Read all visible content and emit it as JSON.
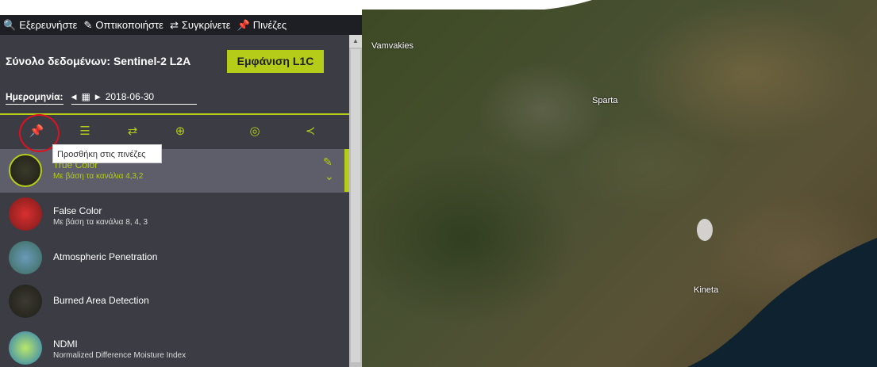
{
  "tabs": [
    {
      "icon": "search-icon",
      "glyph": "🔍",
      "label": "Εξερευνήστε"
    },
    {
      "icon": "brush-icon",
      "glyph": "✎",
      "label": "Οπτικοποιήστε"
    },
    {
      "icon": "compare-icon",
      "glyph": "⇄",
      "label": "Συγκρίνετε"
    },
    {
      "icon": "pin-icon",
      "glyph": "📌",
      "label": "Πινέζες"
    }
  ],
  "dataset": {
    "title": "Σύνολο δεδομένων: Sentinel-2 L2A",
    "button": "Εμφάνιση L1C"
  },
  "date": {
    "label": "Ημερομηνία:",
    "value": "2018-06-30",
    "prev": "◀",
    "next": "▶",
    "calendar": "▦"
  },
  "toolbar": [
    {
      "name": "pin-icon",
      "glyph": "📌"
    },
    {
      "name": "sliders-icon",
      "glyph": "☰"
    },
    {
      "name": "compare-icon",
      "glyph": "⇄"
    },
    {
      "name": "crosshair-icon",
      "glyph": "⊕"
    },
    {
      "name": "eye-slash-icon",
      "glyph": "◎"
    },
    {
      "name": "share-icon",
      "glyph": "≺"
    }
  ],
  "tooltip": "Προσθήκη στις πινέζες",
  "layers": [
    {
      "title": "True Color",
      "subtitle": "Με βάση τα κανάλια 4,3,2",
      "active": true
    },
    {
      "title": "False Color",
      "subtitle": "Με βάση τα κανάλια 8, 4, 3",
      "active": false
    },
    {
      "title": "Atmospheric Penetration",
      "subtitle": "",
      "active": false
    },
    {
      "title": "Burned Area Detection",
      "subtitle": "",
      "active": false
    },
    {
      "title": "NDMI",
      "subtitle": "Normalized Difference Moisture Index",
      "active": false
    }
  ],
  "layer_actions": {
    "edit_glyph": "✎",
    "expand_glyph": "⌄"
  },
  "map": {
    "places": [
      "Vamvakies",
      "Sparta",
      "Kineta"
    ]
  },
  "colors": {
    "accent": "#b5cc18",
    "panel": "#3b3c44",
    "topbar": "#1e1f24",
    "highlight": "#e0101f"
  }
}
